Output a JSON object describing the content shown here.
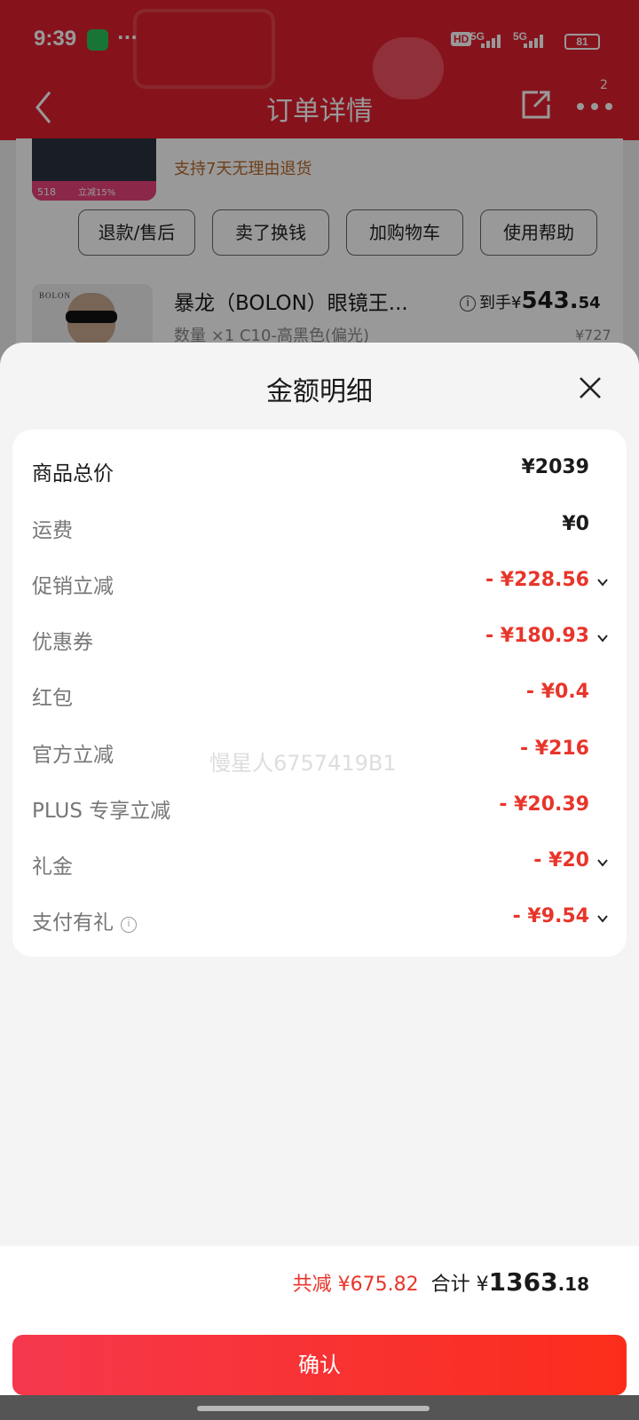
{
  "status_bar": {
    "time": "9:39",
    "network_1": "5G",
    "network_2": "5G",
    "battery": "81",
    "hd_badge": "HD"
  },
  "nav": {
    "title": "订单详情",
    "more_badge": "2"
  },
  "order": {
    "return_note": "支持7天无理由退货",
    "image1_count": "518",
    "image1_tag": "立减15%",
    "buttons": [
      "退款/售后",
      "卖了换钱",
      "加购物车",
      "使用帮助"
    ],
    "product": {
      "brand_logo": "BOLON",
      "name": "暴龙（BOLON）眼镜王...",
      "sub": "数量 ×1 C10-高黑色(偏光)",
      "price_prefix": "到手¥",
      "price_int": "543.",
      "price_dec": "54",
      "old_price": "¥727"
    }
  },
  "sheet": {
    "title": "金额明细",
    "rows": [
      {
        "label": "商品总价",
        "value": "¥2039"
      },
      {
        "label": "运费",
        "value": "¥0"
      },
      {
        "label": "促销立减",
        "value": "- ¥228.56"
      },
      {
        "label": "优惠券",
        "value": "- ¥180.93"
      },
      {
        "label": "红包",
        "value": "- ¥0.4"
      },
      {
        "label": "官方立减",
        "value": "- ¥216"
      },
      {
        "label": "PLUS 专享立减",
        "value": "- ¥20.39"
      },
      {
        "label": "礼金",
        "value": "- ¥20"
      },
      {
        "label": "支付有礼",
        "value": "- ¥9.54"
      }
    ],
    "watermark": "慢星人6757419B1",
    "footer": {
      "saved": "共减 ¥675.82",
      "total_label": "合计",
      "total_currency": "¥",
      "total_int": "1363",
      "total_dec": ".18"
    },
    "confirm_label": "确认"
  },
  "colors": {
    "brand_red": "#e0212f",
    "discount_red": "#e8352a",
    "confirm_gradient_start": "#f6384e",
    "confirm_gradient_end": "#fb2d1a"
  }
}
